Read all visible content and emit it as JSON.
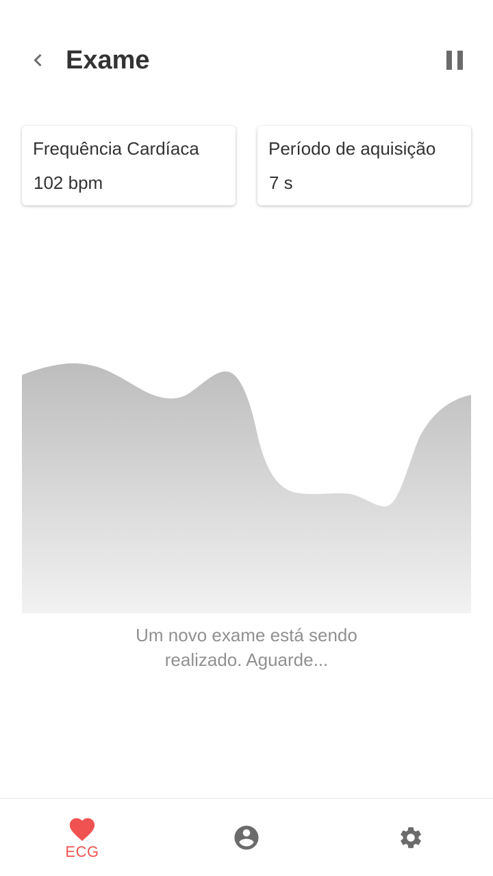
{
  "header": {
    "title": "Exame",
    "back_icon": "chevron-left-icon",
    "pause_icon": "pause-icon"
  },
  "cards": {
    "heart_rate": {
      "label": "Frequência Cardíaca",
      "value": "102 bpm"
    },
    "acquisition_period": {
      "label": "Período de aquisição",
      "value": "7 s"
    }
  },
  "status": {
    "line1": "Um novo exame está sendo",
    "line2": "realizado. Aguarde..."
  },
  "bottom_nav": {
    "items": [
      {
        "label": "ECG",
        "icon": "heart-icon",
        "active": true
      },
      {
        "label": "",
        "icon": "account-circle-icon",
        "active": false
      },
      {
        "label": "",
        "icon": "gear-icon",
        "active": false
      }
    ]
  },
  "colors": {
    "accent": "#f05252",
    "icon_gray": "#6b6b6b",
    "text_dark": "#333333",
    "text_muted": "#909090",
    "wave_top": "#bdbdbd",
    "wave_bottom": "#f2f2f2"
  }
}
